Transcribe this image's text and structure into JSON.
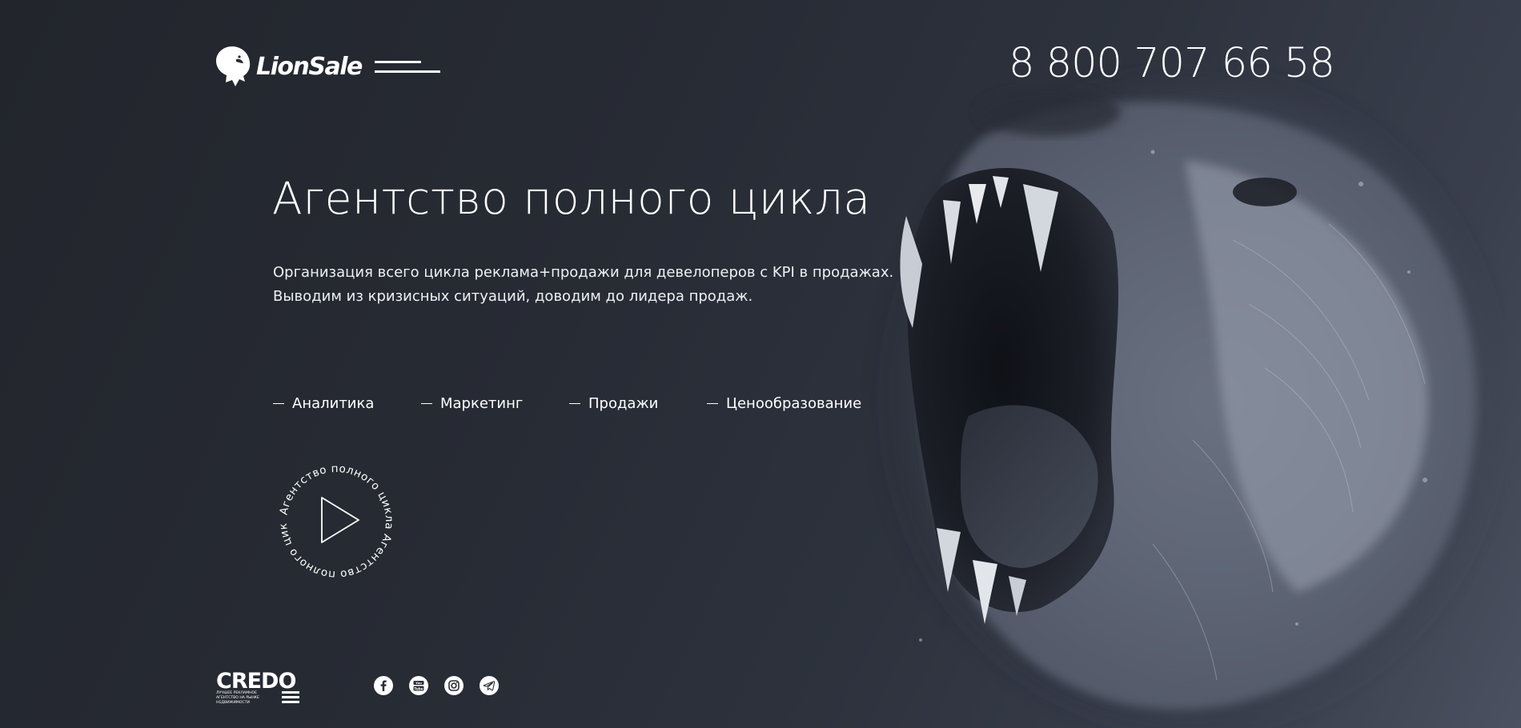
{
  "header": {
    "logo_text": "LionSale",
    "phone": "8 800 707 66 58"
  },
  "hero": {
    "title": "Агентство полного цикла",
    "description_lines": [
      "Организация всего цикла реклама+продажи для девелоперов с KPI в продажах.",
      "Выводим из кризисных ситуаций, доводим до лидера продаж."
    ],
    "services": [
      "Аналитика",
      "Маркетинг",
      "Продажи",
      "Ценообразование"
    ],
    "badge_ring_text": "Агентство полного цикла Агентство полного цикла"
  },
  "footer": {
    "credo_logo_text": "CREDO",
    "credo_caption_lines": [
      "ЛУЧШЕЕ РЕКЛАМНОЕ",
      "АГЕНТСТВО НА РЫНКЕ",
      "НЕДВИЖИМОСТИ"
    ],
    "social_icons": [
      "facebook-icon",
      "youtube-icon",
      "instagram-icon",
      "telegram-icon"
    ]
  },
  "colors": {
    "background_dark": "#22252c",
    "background_light": "#4b5160",
    "text": "#ffffff"
  }
}
